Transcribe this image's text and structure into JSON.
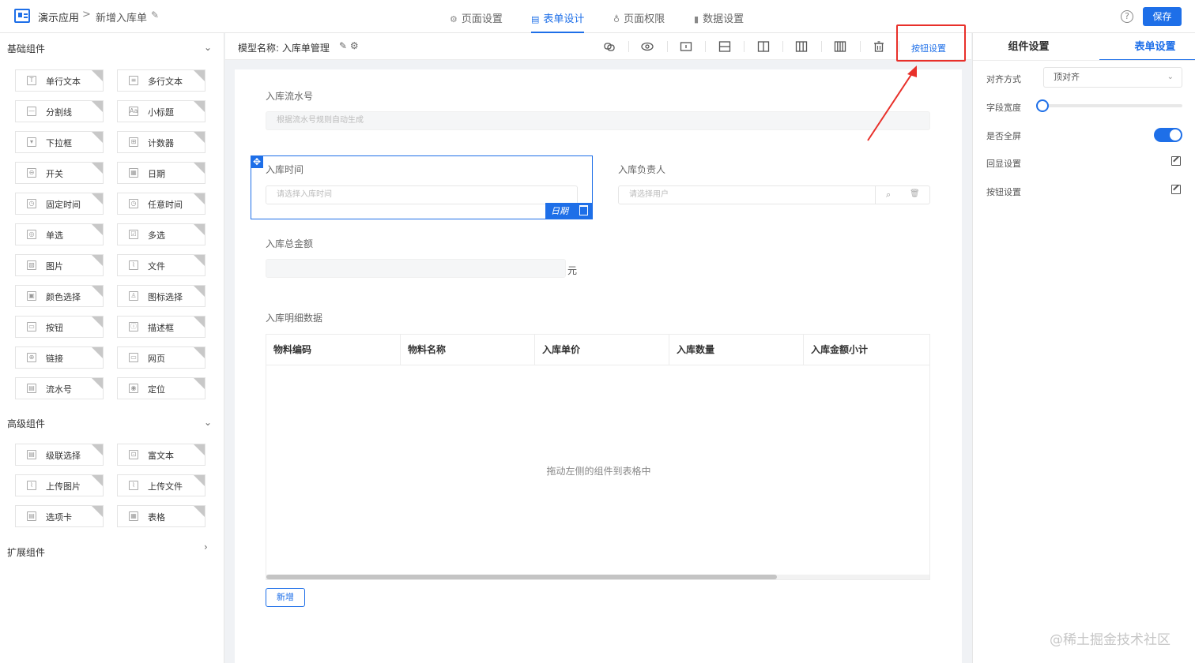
{
  "header": {
    "app_name": "演示应用",
    "separator": ">",
    "page_name": "新增入库单",
    "tabs": [
      {
        "label": "页面设置",
        "icon": "gear-icon"
      },
      {
        "label": "表单设计",
        "icon": "document-icon"
      },
      {
        "label": "页面权限",
        "icon": "key-icon"
      },
      {
        "label": "数据设置",
        "icon": "bar-chart-icon"
      }
    ],
    "active_tab": "表单设计",
    "help": "?",
    "save_label": "保存"
  },
  "left_panel": {
    "basic": {
      "title": "基础组件",
      "items": [
        "单行文本",
        "多行文本",
        "分割线",
        "小标题",
        "下拉框",
        "计数器",
        "开关",
        "日期",
        "固定时间",
        "任意时间",
        "单选",
        "多选",
        "图片",
        "文件",
        "颜色选择",
        "图标选择",
        "按钮",
        "描述框",
        "链接",
        "网页",
        "流水号",
        "定位"
      ]
    },
    "advanced": {
      "title": "高级组件",
      "items": [
        "级联选择",
        "富文本",
        "上传图片",
        "上传文件",
        "选项卡",
        "表格"
      ]
    },
    "extension": {
      "title": "扩展组件"
    }
  },
  "toolbar": {
    "model_label": "模型名称: 入库单管理",
    "button_setting": "按钮设置"
  },
  "form": {
    "serial_label": "入库流水号",
    "serial_placeholder": "根据流水号规则自动生成",
    "time_label": "入库时间",
    "time_placeholder": "请选择入库时间",
    "selected_tag": "日期",
    "owner_label": "入库负责人",
    "owner_placeholder": "请选择用户",
    "amount_label": "入库总金额",
    "amount_unit": "元",
    "detail_label": "入库明细数据",
    "table_headers": [
      "物料编码",
      "物料名称",
      "入库单价",
      "入库数量",
      "入库金额小计"
    ],
    "table_empty": "拖动左侧的组件到表格中",
    "add_label": "新增"
  },
  "right_panel": {
    "tabs": [
      "组件设置",
      "表单设置"
    ],
    "active_tab": "表单设置",
    "align_label": "对齐方式",
    "align_value": "顶对齐",
    "width_label": "字段宽度",
    "width_value": 0,
    "fullscreen_label": "是否全屏",
    "fullscreen_on": true,
    "echo_label": "回显设置",
    "button_label": "按钮设置"
  },
  "watermark": "@稀土掘金技术社区",
  "colors": {
    "accent": "#1e6fe8",
    "highlight": "#e8302a"
  }
}
